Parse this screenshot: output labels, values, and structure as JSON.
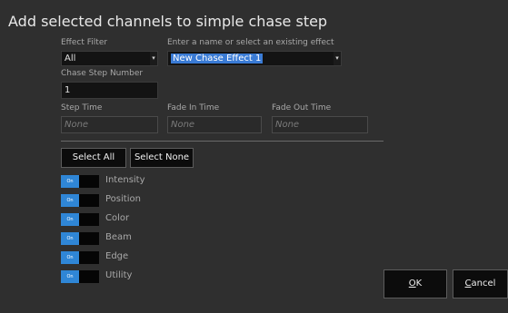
{
  "dialog": {
    "title": "Add selected channels to simple chase step",
    "effect_filter_label": "Effect Filter",
    "effect_filter_value": "All",
    "effect_name_label": "Enter a name or select an existing effect",
    "effect_name_value": "New Chase Effect 1",
    "chase_step_number_label": "Chase Step Number",
    "chase_step_number_value": "1",
    "step_time_label": "Step Time",
    "step_time_value": "None",
    "fade_in_label": "Fade In Time",
    "fade_in_value": "None",
    "fade_out_label": "Fade Out Time",
    "fade_out_value": "None",
    "select_all_label": "Select All",
    "select_none_label": "Select None",
    "toggles": [
      {
        "state": "On",
        "label": "Intensity"
      },
      {
        "state": "On",
        "label": "Position"
      },
      {
        "state": "On",
        "label": "Color"
      },
      {
        "state": "On",
        "label": "Beam"
      },
      {
        "state": "On",
        "label": "Edge"
      },
      {
        "state": "On",
        "label": "Utility"
      }
    ],
    "ok_mnemonic": "O",
    "ok_rest": "K",
    "cancel_mnemonic": "C",
    "cancel_rest": "ancel"
  },
  "colors": {
    "background": "#2f2f2f",
    "toggle_on": "#2f86d6",
    "selection": "#3a7bd5"
  }
}
